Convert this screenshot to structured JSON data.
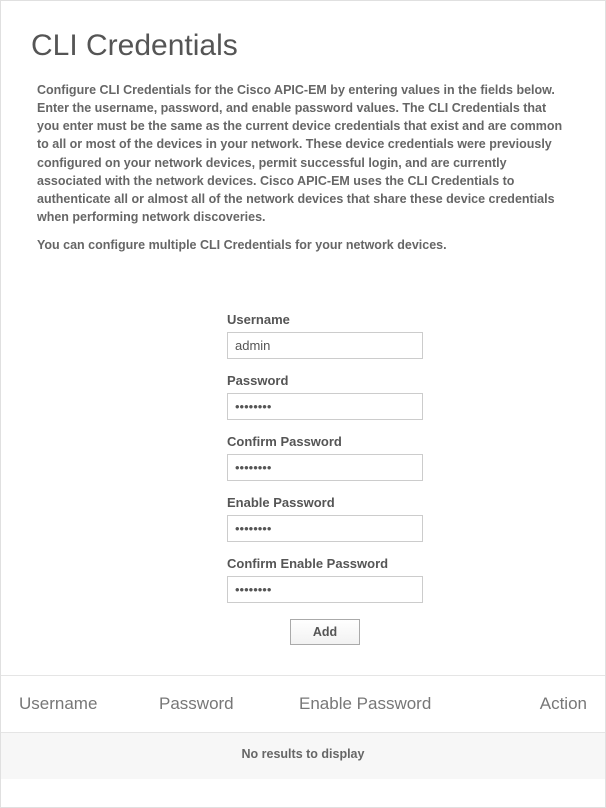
{
  "title": "CLI Credentials",
  "description": "Configure CLI Credentials for the Cisco APIC-EM by entering values in the fields below. Enter the username, password, and enable password values. The CLI Credentials that you enter must be the same as the current device credentials that exist and are common to all or most of the devices in your network. These device credentials were previously configured on your network devices, permit successful login, and are currently associated with the network devices. Cisco APIC-EM uses the CLI Credentials to authenticate all or almost all of the network devices that share these device credentials when performing network discoveries.",
  "subtext": "You can configure multiple CLI Credentials for your network devices.",
  "form": {
    "username": {
      "label": "Username",
      "value": "admin"
    },
    "password": {
      "label": "Password",
      "value": "••••••••"
    },
    "confirm_password": {
      "label": "Confirm Password",
      "value": "••••••••"
    },
    "enable_password": {
      "label": "Enable Password",
      "value": "••••••••"
    },
    "confirm_enable_password": {
      "label": "Confirm Enable Password",
      "value": "••••••••"
    },
    "add_button": "Add"
  },
  "table": {
    "headers": {
      "username": "Username",
      "password": "Password",
      "enable_password": "Enable Password",
      "action": "Action"
    },
    "no_results": "No results to display"
  }
}
